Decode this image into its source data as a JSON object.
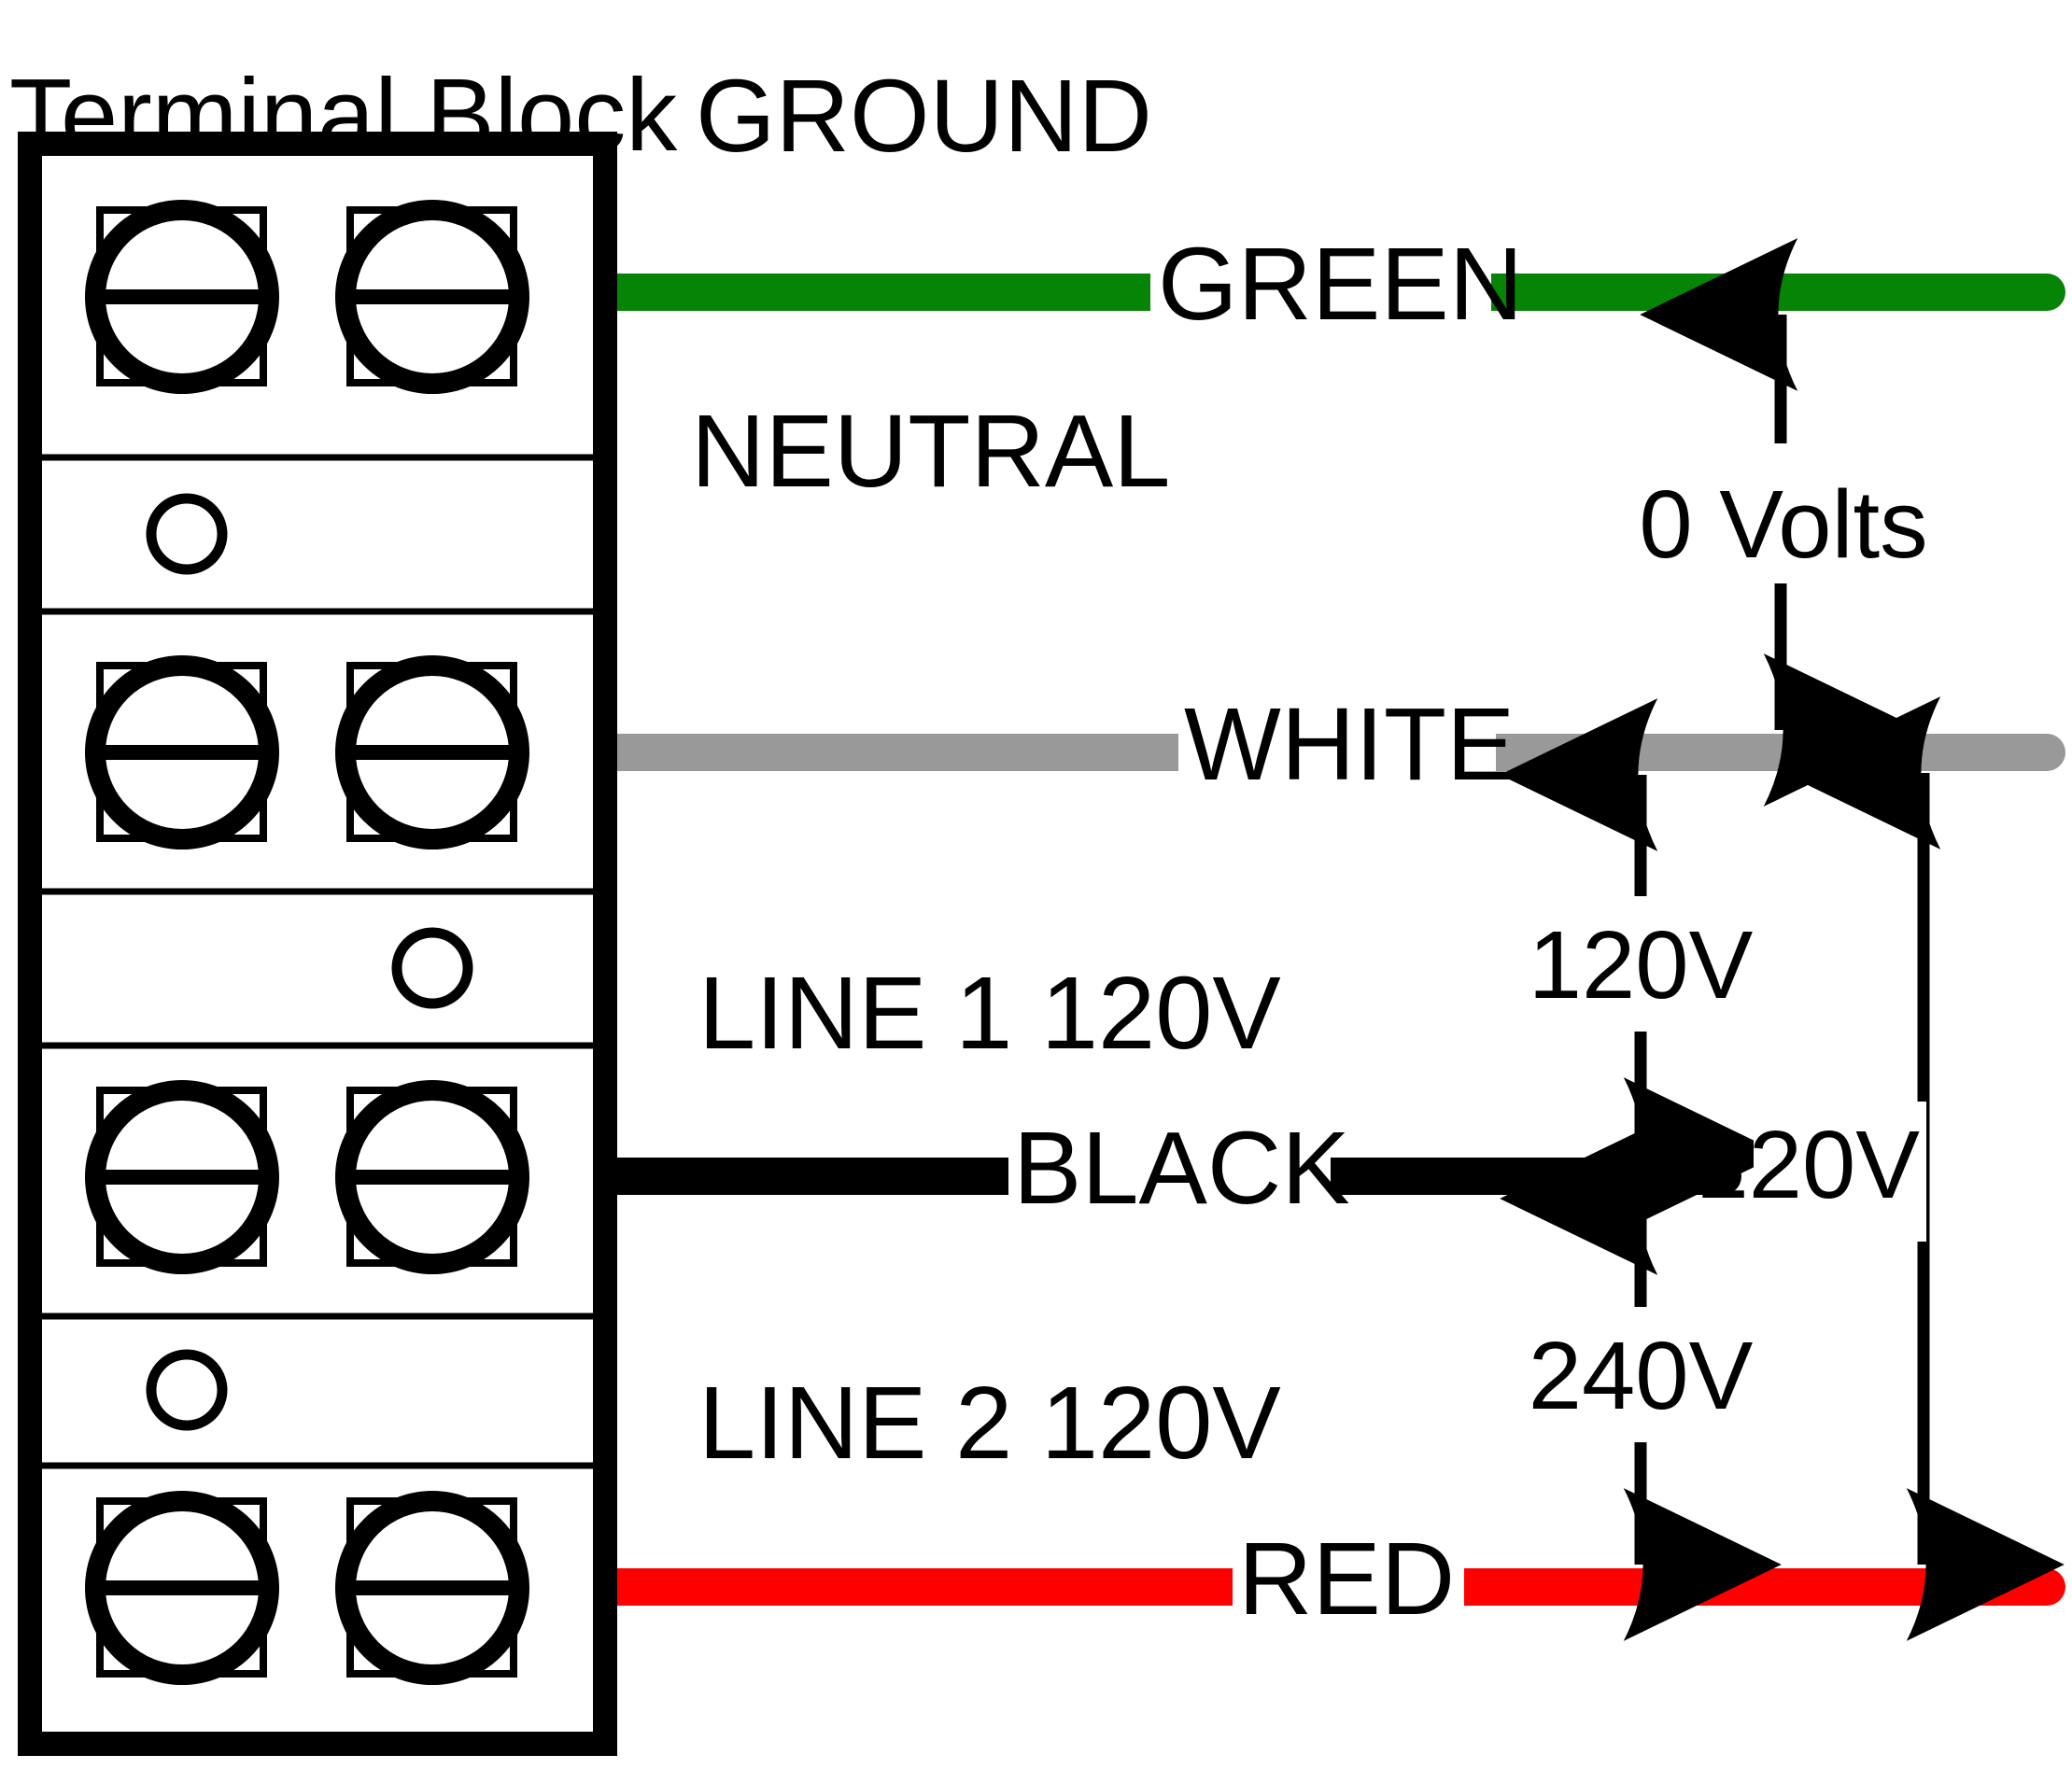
{
  "diagram": {
    "title": "Terminal Block",
    "type": "electrical-wiring-diagram",
    "background_color": "#ffffff"
  },
  "terminal_block": {
    "label": "Terminal Block",
    "outline_color": "#000000",
    "screw_rows": 4,
    "divider_rows": 3,
    "screws_per_row": 2,
    "divider_hole_label": ""
  },
  "conductors": [
    {
      "function_label": "GROUND",
      "wire_label": "GREEN",
      "color": "#068406",
      "color_name": "green"
    },
    {
      "function_label": "NEUTRAL",
      "wire_label": "WHITE",
      "color": "#999999",
      "color_name": "white"
    },
    {
      "function_label": "LINE 1  120V",
      "wire_label": "BLACK",
      "color": "#000000",
      "color_name": "black"
    },
    {
      "function_label": "LINE 2  120V",
      "wire_label": "RED",
      "color": "#FF0000",
      "color_name": "red"
    }
  ],
  "measurements": [
    {
      "id": "ground-to-neutral",
      "label": "0 Volts",
      "from": "GREEN",
      "to": "WHITE",
      "value": 0,
      "unit": "Volts"
    },
    {
      "id": "neutral-to-line1",
      "label": "120V",
      "from": "WHITE",
      "to": "BLACK",
      "value": 120,
      "unit": "V"
    },
    {
      "id": "line1-to-line2",
      "label": "240V",
      "from": "BLACK",
      "to": "RED",
      "value": 240,
      "unit": "V"
    },
    {
      "id": "neutral-to-line2",
      "label": "120V",
      "from": "WHITE",
      "to": "RED",
      "value": 120,
      "unit": "V"
    }
  ]
}
